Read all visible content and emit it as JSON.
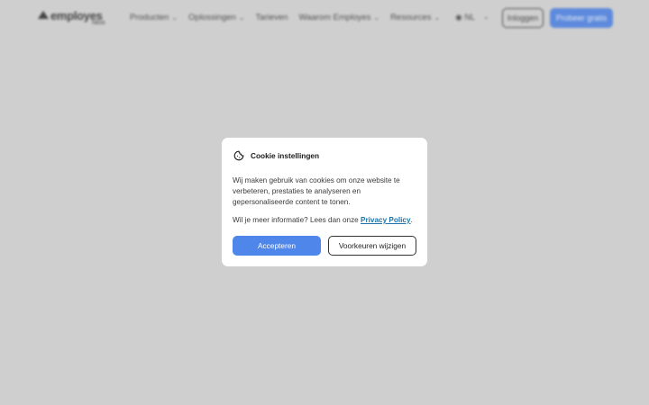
{
  "header": {
    "logo_text": "employes",
    "logo_sub": "hibob",
    "nav_items": [
      {
        "label": "Producten",
        "has_dropdown": true
      },
      {
        "label": "Oplossingen",
        "has_dropdown": true
      },
      {
        "label": "Tarieven",
        "has_dropdown": false
      },
      {
        "label": "Waarom Employes",
        "has_dropdown": true
      },
      {
        "label": "Resources",
        "has_dropdown": true
      }
    ],
    "language": "NL",
    "login_label": "Inloggen",
    "trial_label": "Probeer gratis"
  },
  "cookie_modal": {
    "title": "Cookie instellingen",
    "body": "Wij maken gebruik van cookies om onze website te verbeteren, prestaties te analyseren en gepersonaliseerde content te tonen.",
    "more_prefix": "Wil je meer informatie? Lees dan onze",
    "policy_link": "Privacy Policy",
    "more_suffix": ".",
    "accept_label": "Accepteren",
    "prefs_label": "Voorkeuren wijzigen"
  },
  "colors": {
    "overlay": "#cfcfcf",
    "accent": "#4f86ea",
    "link": "#1e74a8"
  }
}
